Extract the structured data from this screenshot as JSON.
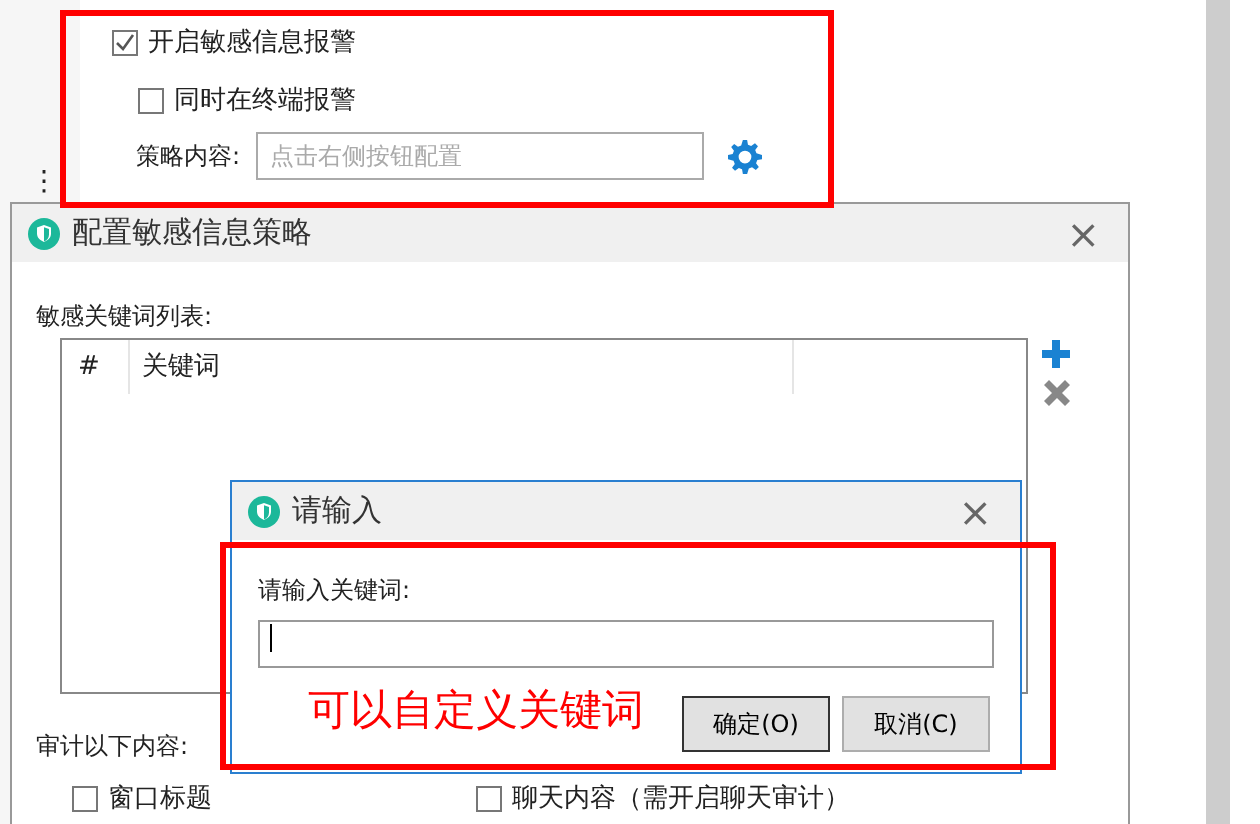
{
  "background": {
    "settings": [
      {
        "kind": "checkbox",
        "label": "开启敏感信息报警",
        "checked": true
      },
      {
        "kind": "checkbox",
        "label": "同时在终端报警",
        "checked": false
      },
      {
        "kind": "field",
        "label": "策略内容:",
        "placeholder": "点击右侧按钮配置"
      }
    ],
    "more_symbol": "⋮"
  },
  "policy_dialog": {
    "title": "配置敏感信息策略",
    "close": "×",
    "list_label": "敏感关键词列表:",
    "table": {
      "columns": [
        "#",
        "关键词"
      ]
    },
    "audit_label": "审计以下内容:",
    "audit_items": [
      {
        "label": "窗口标题",
        "checked": false
      },
      {
        "label": "聊天内容（需开启聊天审计）",
        "checked": false
      }
    ]
  },
  "input_dialog": {
    "title": "请输入",
    "close": "×",
    "prompt": "请输入关键词:",
    "buttons": [
      {
        "label": "确定(O)",
        "default": true
      },
      {
        "label": "取消(C)",
        "default": false
      }
    ]
  },
  "annotation": {
    "text": "可以自定义关键词"
  }
}
